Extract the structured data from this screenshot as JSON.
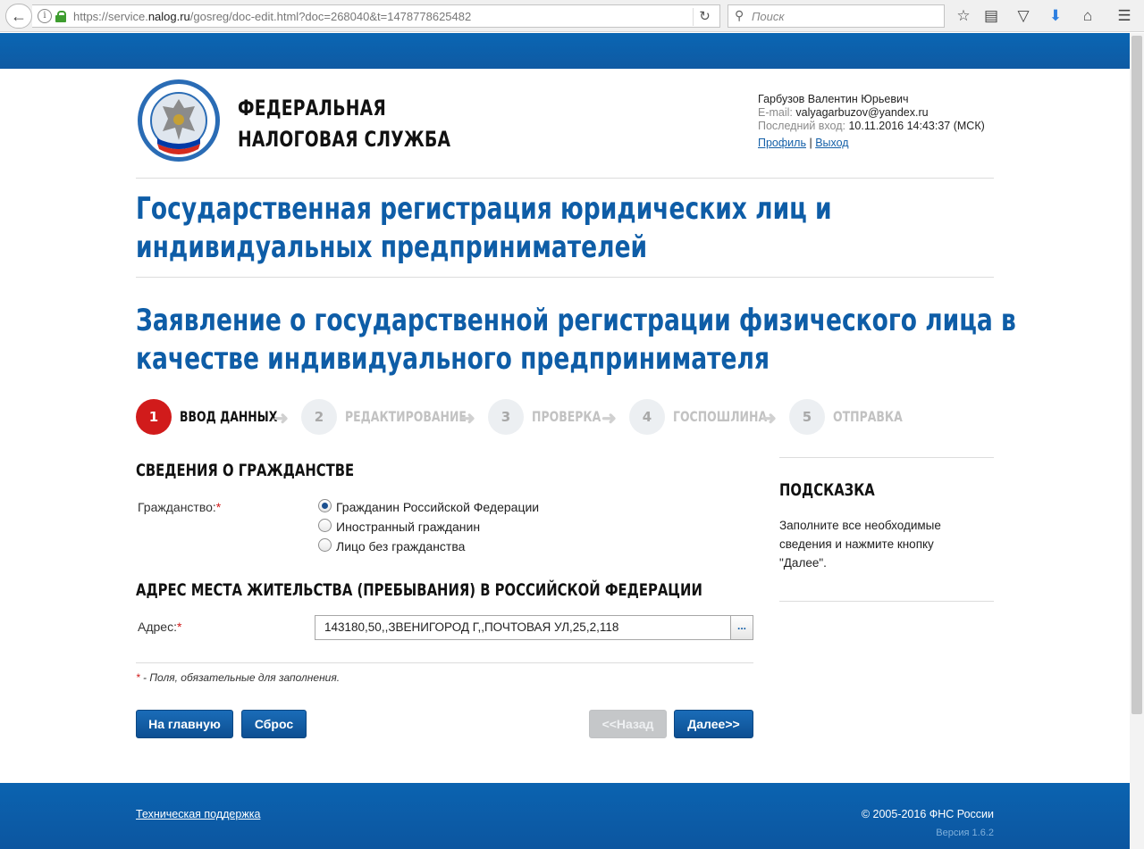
{
  "browser": {
    "url_prefix": "https://service.",
    "url_host": "nalog.ru",
    "url_path": "/gosreg/doc-edit.html?doc=268040&t=1478778625482",
    "search_placeholder": "Поиск"
  },
  "header": {
    "org_line1": "ФЕДЕРАЛЬНАЯ",
    "org_line2": "НАЛОГОВАЯ СЛУЖБА",
    "user_name": "Гарбузов Валентин Юрьевич",
    "email_label": "E-mail:",
    "email": "valyagarbuzov@yandex.ru",
    "last_login_label": "Последний вход:",
    "last_login": "10.11.2016 14:43:37 (МСК)",
    "profile_link": "Профиль",
    "separator": "|",
    "logout_link": "Выход"
  },
  "titles": {
    "service_line1": "Государственная регистрация юридических лиц и",
    "service_line2": "индивидуальных предпринимателей",
    "form_line1": "Заявление о государственной регистрации физического лица в",
    "form_line2": "качестве индивидуального предпринимателя"
  },
  "steps": [
    {
      "num": "1",
      "label": "ВВОД ДАННЫХ",
      "active": true
    },
    {
      "num": "2",
      "label": "РЕДАКТИРОВАНИЕ",
      "active": false
    },
    {
      "num": "3",
      "label": "ПРОВЕРКА",
      "active": false
    },
    {
      "num": "4",
      "label": "ГОСПОШЛИНА",
      "active": false
    },
    {
      "num": "5",
      "label": "ОТПРАВКА",
      "active": false
    }
  ],
  "citizenship": {
    "section_title": "СВЕДЕНИЯ О ГРАЖДАНСТВЕ",
    "label": "Гражданство:",
    "required_mark": "*",
    "options": [
      {
        "label": "Гражданин Российской Федерации",
        "checked": true
      },
      {
        "label": "Иностранный гражданин",
        "checked": false
      },
      {
        "label": "Лицо без гражданства",
        "checked": false
      }
    ]
  },
  "address": {
    "section_title": "АДРЕС МЕСТА ЖИТЕЛЬСТВА (ПРЕБЫВАНИЯ) В РОССИЙСКОЙ ФЕДЕРАЦИИ",
    "label": "Адрес:",
    "required_mark": "*",
    "value": "143180,50,,ЗВЕНИГОРОД Г,,ПОЧТОВАЯ УЛ,25,2,118",
    "picker_label": "..."
  },
  "note": {
    "mark": "*",
    "text": " - Поля, обязательные для заполнения."
  },
  "buttons": {
    "home": "На главную",
    "reset": "Сброс",
    "back": "<<Назад",
    "next": "Далее>>"
  },
  "hint": {
    "title": "ПОДСКАЗКА",
    "text": "Заполните все необходимые сведения и нажмите кнопку \"Далее\"."
  },
  "footer": {
    "support_link": "Техническая поддержка",
    "copyright": "© 2005-2016 ФНС России",
    "version": "Версия 1.6.2"
  },
  "colors": {
    "brand_blue": "#0e5da7",
    "active_step": "#d11b1b"
  }
}
